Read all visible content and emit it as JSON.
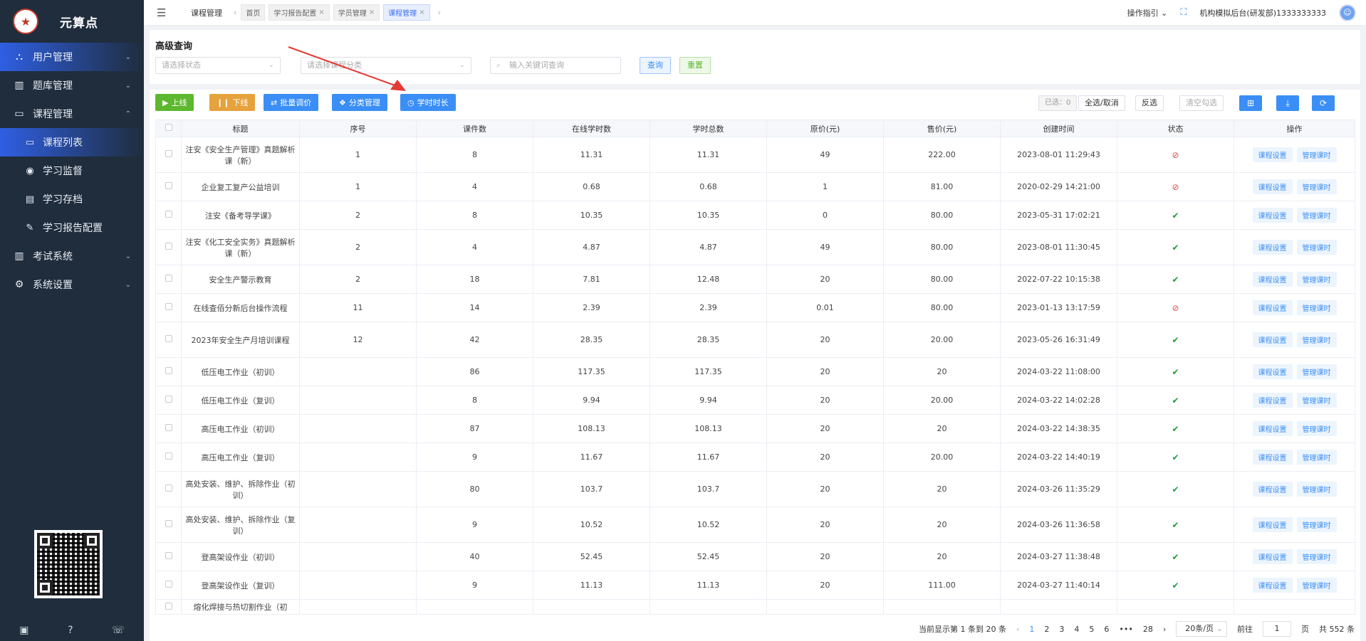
{
  "sidebar": {
    "logo_text": "元算点",
    "menu": [
      {
        "label": "用户管理",
        "icon": "users-icon"
      },
      {
        "label": "题库管理",
        "icon": "library-icon"
      },
      {
        "label": "课程管理",
        "icon": "book-icon"
      },
      {
        "label": "考试系统",
        "icon": "exam-icon"
      },
      {
        "label": "系统设置",
        "icon": "gear-icon"
      }
    ],
    "course_sub": [
      {
        "label": "课程列表",
        "icon": "book-icon"
      },
      {
        "label": "学习监督",
        "icon": "eye-icon"
      },
      {
        "label": "学习存档",
        "icon": "file-icon"
      },
      {
        "label": "学习报告配置",
        "icon": "pen-icon"
      }
    ]
  },
  "topbar": {
    "breadcrumb": "课程管理",
    "tabs": [
      "首页",
      "学习报告配置",
      "学员管理",
      "课程管理"
    ],
    "guide": "操作指引",
    "org": "机构模拟后台(研发部)1333333333"
  },
  "search": {
    "title": "高级查询",
    "status_placeholder": "请选择状态",
    "category_placeholder": "请选择课程分类",
    "keyword_placeholder": "输入关键词查询",
    "query": "查询",
    "reset": "重置"
  },
  "toolbar": {
    "online": "上线",
    "offline": "下线",
    "batch_price": "批量调价",
    "category": "分类管理",
    "hours": "学时时长",
    "selected": "已选：0",
    "select_all": "全选/取消",
    "invert": "反选",
    "clear": "清空勾选"
  },
  "table": {
    "headers": [
      "标题",
      "序号",
      "课件数",
      "在线学时数",
      "学时总数",
      "原价(元)",
      "售价(元)",
      "创建时间",
      "状态",
      "操作"
    ],
    "op1": "课程设置",
    "op2": "管理课时",
    "rows": [
      {
        "title": "注安《安全生产管理》真题解析课（新）",
        "seq": "1",
        "count": "8",
        "online": "11.31",
        "total": "11.31",
        "orig": "49",
        "price": "222.00",
        "created": "2023-08-01 11:29:43",
        "ok": false
      },
      {
        "title": "企业复工复产公益培训",
        "seq": "1",
        "count": "4",
        "online": "0.68",
        "total": "0.68",
        "orig": "1",
        "price": "81.00",
        "created": "2020-02-29 14:21:00",
        "ok": false
      },
      {
        "title": "注安《备考导学课》",
        "seq": "2",
        "count": "8",
        "online": "10.35",
        "total": "10.35",
        "orig": "0",
        "price": "80.00",
        "created": "2023-05-31 17:02:21",
        "ok": true
      },
      {
        "title": "注安《化工安全实务》真题解析课（新）",
        "seq": "2",
        "count": "4",
        "online": "4.87",
        "total": "4.87",
        "orig": "49",
        "price": "80.00",
        "created": "2023-08-01 11:30:45",
        "ok": true
      },
      {
        "title": "安全生产警示教育",
        "seq": "2",
        "count": "18",
        "online": "7.81",
        "total": "12.48",
        "orig": "20",
        "price": "80.00",
        "created": "2022-07-22 10:15:38",
        "ok": true
      },
      {
        "title": "在线查佰分新后台操作流程",
        "seq": "11",
        "count": "14",
        "online": "2.39",
        "total": "2.39",
        "orig": "0.01",
        "price": "80.00",
        "created": "2023-01-13 13:17:59",
        "ok": false
      },
      {
        "title": "2023年安全生产月培训课程",
        "seq": "12",
        "count": "42",
        "online": "28.35",
        "total": "28.35",
        "orig": "20",
        "price": "20.00",
        "created": "2023-05-26 16:31:49",
        "ok": true
      },
      {
        "title": "低压电工作业（初训）",
        "seq": "",
        "count": "86",
        "online": "117.35",
        "total": "117.35",
        "orig": "20",
        "price": "20",
        "created": "2024-03-22 11:08:00",
        "ok": true
      },
      {
        "title": "低压电工作业（复训）",
        "seq": "",
        "count": "8",
        "online": "9.94",
        "total": "9.94",
        "orig": "20",
        "price": "20.00",
        "created": "2024-03-22 14:02:28",
        "ok": true
      },
      {
        "title": "高压电工作业（初训）",
        "seq": "",
        "count": "87",
        "online": "108.13",
        "total": "108.13",
        "orig": "20",
        "price": "20",
        "created": "2024-03-22 14:38:35",
        "ok": true
      },
      {
        "title": "高压电工作业（复训）",
        "seq": "",
        "count": "9",
        "online": "11.67",
        "total": "11.67",
        "orig": "20",
        "price": "20.00",
        "created": "2024-03-22 14:40:19",
        "ok": true
      },
      {
        "title": "高处安装、维护、拆除作业（初训）",
        "seq": "",
        "count": "80",
        "online": "103.7",
        "total": "103.7",
        "orig": "20",
        "price": "20",
        "created": "2024-03-26 11:35:29",
        "ok": true
      },
      {
        "title": "高处安装、维护、拆除作业（复训）",
        "seq": "",
        "count": "9",
        "online": "10.52",
        "total": "10.52",
        "orig": "20",
        "price": "20",
        "created": "2024-03-26 11:36:58",
        "ok": true
      },
      {
        "title": "登高架设作业（初训）",
        "seq": "",
        "count": "40",
        "online": "52.45",
        "total": "52.45",
        "orig": "20",
        "price": "20",
        "created": "2024-03-27 11:38:48",
        "ok": true
      },
      {
        "title": "登高架设作业（复训）",
        "seq": "",
        "count": "9",
        "online": "11.13",
        "total": "11.13",
        "orig": "20",
        "price": "111.00",
        "created": "2024-03-27 11:40:14",
        "ok": true
      },
      {
        "title": "熔化焊接与热切割作业（初",
        "seq": "",
        "count": "",
        "online": "",
        "total": "",
        "orig": "",
        "price": "",
        "created": "",
        "ok": null
      }
    ]
  },
  "pager": {
    "summary": "当前显示第 1 条到 20 条",
    "pages": [
      "1",
      "2",
      "3",
      "4",
      "5",
      "6",
      "•••",
      "28"
    ],
    "size": "20条/页",
    "goto": "前往",
    "page_value": "1",
    "page_unit": "页",
    "total": "共 552 条"
  },
  "colors": {
    "sidebar": "#1f2d3d",
    "primary": "#3a8ef6",
    "success": "#5cb82e",
    "warning": "#e6a23c",
    "danger": "#e04b4b"
  }
}
